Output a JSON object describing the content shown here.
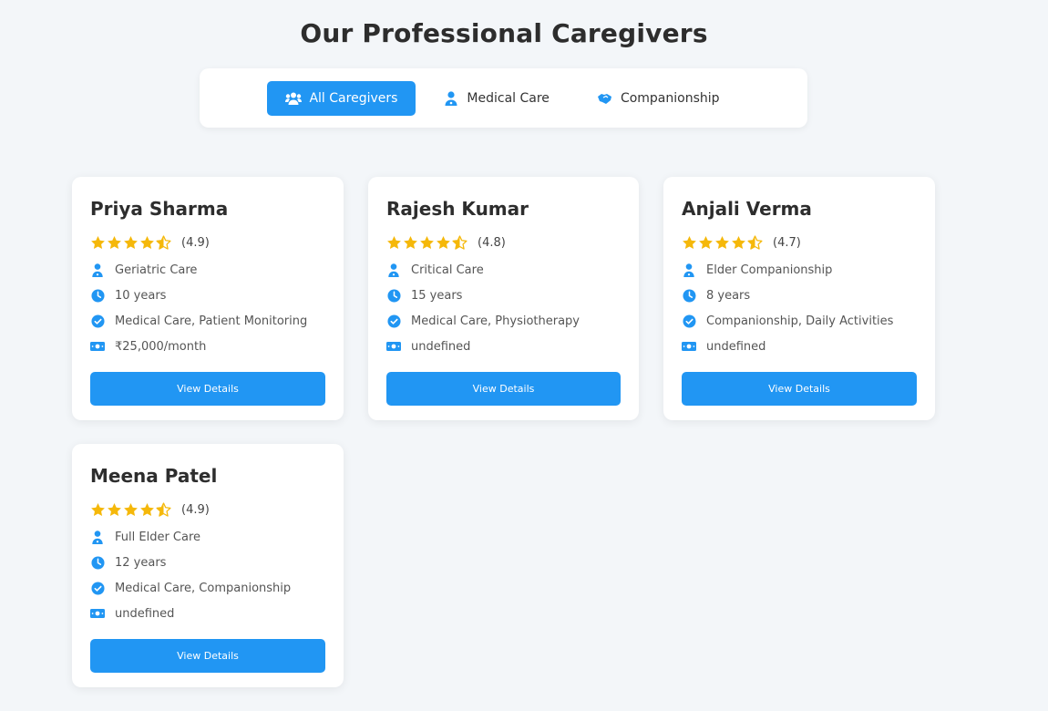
{
  "page": {
    "title": "Our Professional Caregivers"
  },
  "filters": [
    {
      "label": "All Caregivers",
      "icon": "users-icon",
      "active": true
    },
    {
      "label": "Medical Care",
      "icon": "user-doctor-icon",
      "active": false
    },
    {
      "label": "Companionship",
      "icon": "handshake-icon",
      "active": false
    }
  ],
  "colors": {
    "accent": "#2196f3",
    "star": "#f5b80a",
    "background": "#f3f6f9"
  },
  "caregivers": [
    {
      "name": "Priya Sharma",
      "rating": "(4.9)",
      "stars": 4.5,
      "specialty": "Geriatric Care",
      "experience": "10 years",
      "services": "Medical Care, Patient Monitoring",
      "rate": "₹25,000/month",
      "button": "View Details"
    },
    {
      "name": "Rajesh Kumar",
      "rating": "(4.8)",
      "stars": 4.5,
      "specialty": "Critical Care",
      "experience": "15 years",
      "services": "Medical Care, Physiotherapy",
      "rate": "undefined",
      "button": "View Details"
    },
    {
      "name": "Anjali Verma",
      "rating": "(4.7)",
      "stars": 4.5,
      "specialty": "Elder Companionship",
      "experience": "8 years",
      "services": "Companionship, Daily Activities",
      "rate": "undefined",
      "button": "View Details"
    },
    {
      "name": "Meena Patel",
      "rating": "(4.9)",
      "stars": 4.5,
      "specialty": "Full Elder Care",
      "experience": "12 years",
      "services": "Medical Care, Companionship",
      "rate": "undefined",
      "button": "View Details"
    }
  ]
}
